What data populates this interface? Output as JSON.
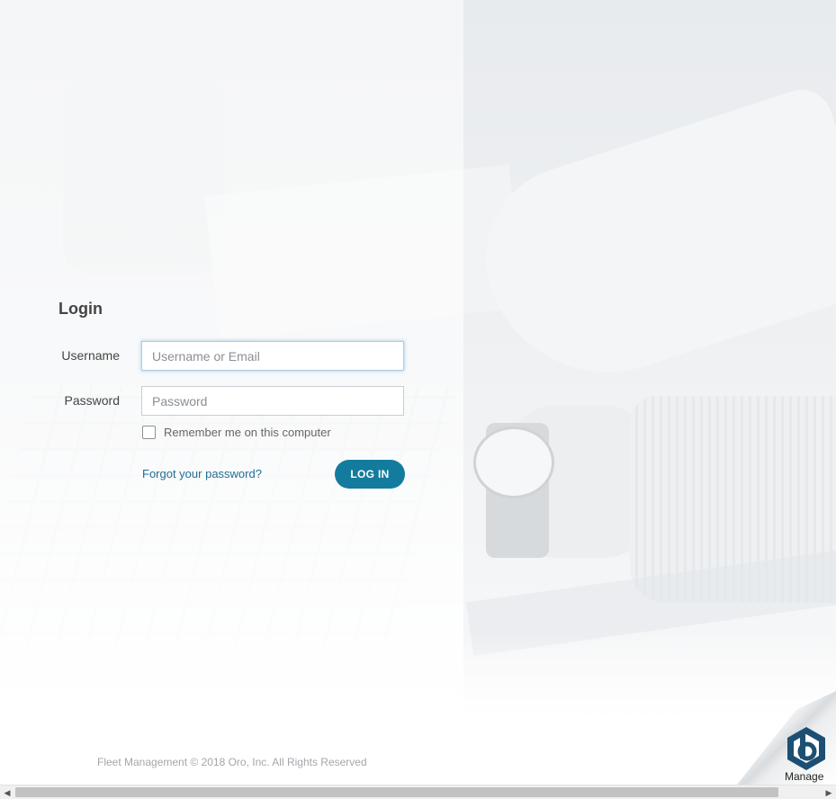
{
  "login": {
    "title": "Login",
    "username_label": "Username",
    "username_placeholder": "Username or Email",
    "username_value": "",
    "password_label": "Password",
    "password_placeholder": "Password",
    "password_value": "",
    "remember_label": "Remember me on this computer",
    "remember_checked": false,
    "forgot_link": "Forgot your password?",
    "submit_label": "LOG IN"
  },
  "footer": {
    "copyright": "Fleet Management © 2018 Oro, Inc. All Rights Reserved"
  },
  "badge": {
    "label": "Manage",
    "icon": "hexagon-b-logo-icon"
  },
  "colors": {
    "accent": "#137c9e",
    "link": "#1f6e93"
  }
}
